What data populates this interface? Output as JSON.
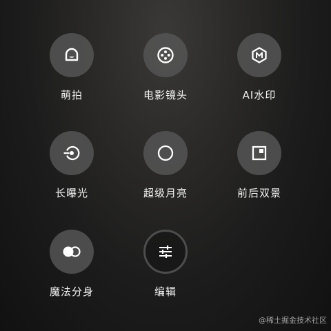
{
  "tiles": [
    {
      "id": "meng-pai",
      "label": "萌拍",
      "icon": "cute-face-icon"
    },
    {
      "id": "movie-lens",
      "label": "电影镜头",
      "icon": "film-reel-icon"
    },
    {
      "id": "ai-watermark",
      "label": "AI水印",
      "icon": "hexagon-m-icon"
    },
    {
      "id": "long-exposure",
      "label": "长曝光",
      "icon": "long-exposure-icon"
    },
    {
      "id": "super-moon",
      "label": "超级月亮",
      "icon": "moon-circle-icon"
    },
    {
      "id": "dual-view",
      "label": "前后双景",
      "icon": "dual-frame-icon"
    },
    {
      "id": "clone",
      "label": "魔法分身",
      "icon": "clone-circles-icon"
    },
    {
      "id": "edit",
      "label": "编辑",
      "icon": "sliders-icon"
    }
  ],
  "watermark": "@稀土掘金技术社区",
  "colors": {
    "button_fill": "#555555",
    "icon": "#ffffff",
    "label": "#f2f2f2"
  }
}
